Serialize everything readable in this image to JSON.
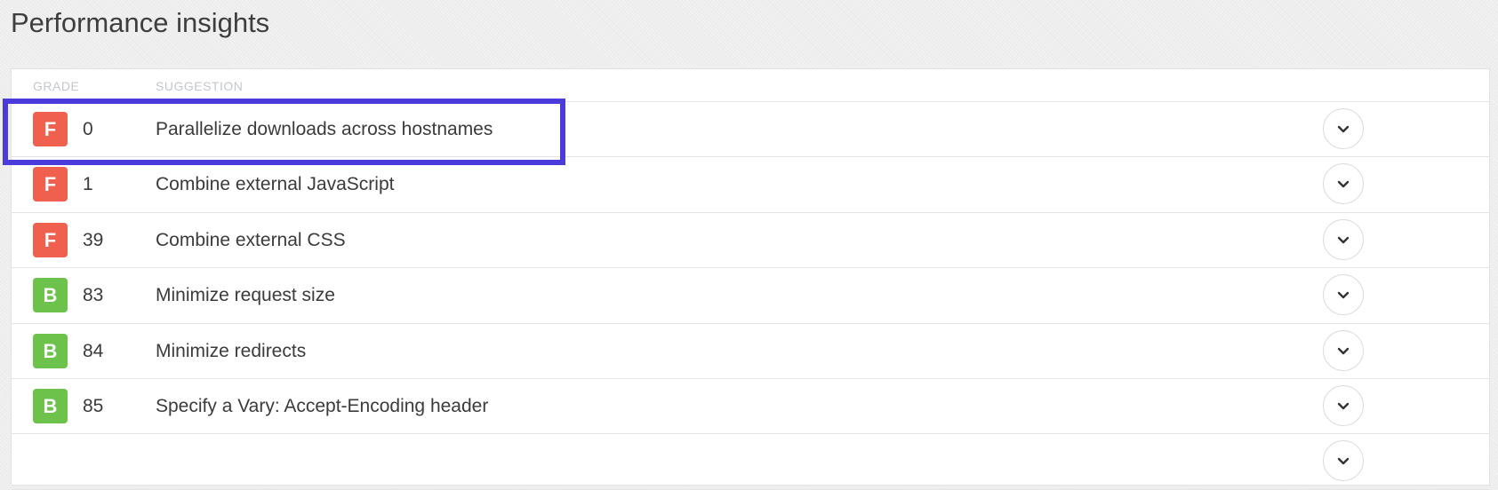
{
  "page": {
    "title": "Performance insights"
  },
  "table": {
    "headers": {
      "grade": "GRADE",
      "suggestion": "SUGGESTION"
    },
    "rows": [
      {
        "grade": "F",
        "score": "0",
        "suggestion": "Parallelize downloads across hostnames",
        "grade_color": "#f0604e"
      },
      {
        "grade": "F",
        "score": "1",
        "suggestion": "Combine external JavaScript",
        "grade_color": "#f0604e"
      },
      {
        "grade": "F",
        "score": "39",
        "suggestion": "Combine external CSS",
        "grade_color": "#f0604e"
      },
      {
        "grade": "B",
        "score": "83",
        "suggestion": "Minimize request size",
        "grade_color": "#6cc24a"
      },
      {
        "grade": "B",
        "score": "84",
        "suggestion": "Minimize redirects",
        "grade_color": "#6cc24a"
      },
      {
        "grade": "B",
        "score": "85",
        "suggestion": "Specify a Vary: Accept-Encoding header",
        "grade_color": "#6cc24a"
      }
    ],
    "expand_icon": "chevron-down-icon"
  },
  "highlight": {
    "color": "#4b3bdb"
  }
}
